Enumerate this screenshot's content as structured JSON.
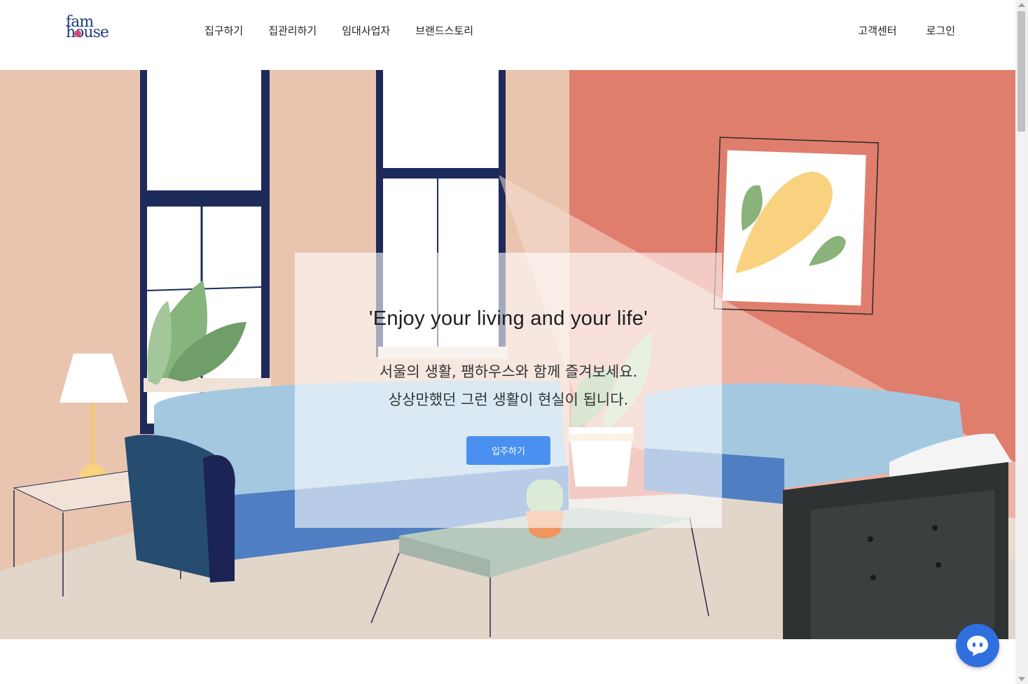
{
  "header": {
    "logo": {
      "line1": "fam",
      "line2": "house"
    },
    "nav": [
      {
        "label": "집구하기"
      },
      {
        "label": "집관리하기"
      },
      {
        "label": "임대사업자"
      },
      {
        "label": "브랜드스토리"
      }
    ],
    "utility": [
      {
        "label": "고객센터"
      },
      {
        "label": "로그인"
      }
    ]
  },
  "hero": {
    "headline": "'Enjoy your living and your life'",
    "subline1": "서울의 생활, 팸하우스와 함께 즐겨보세요.",
    "subline2": "상상만했던 그런 생활이 현실이 됩니다.",
    "cta_label": "입주하기",
    "illustration": "living-room-illustration"
  },
  "colors": {
    "accent": "#4a90f0",
    "brand": "#1f3a7a",
    "wall_left": "#e9c5b0",
    "wall_right": "#e07e6d",
    "chat_button": "#2f6fe0"
  },
  "chat": {
    "icon": "chat-bubble-icon"
  }
}
